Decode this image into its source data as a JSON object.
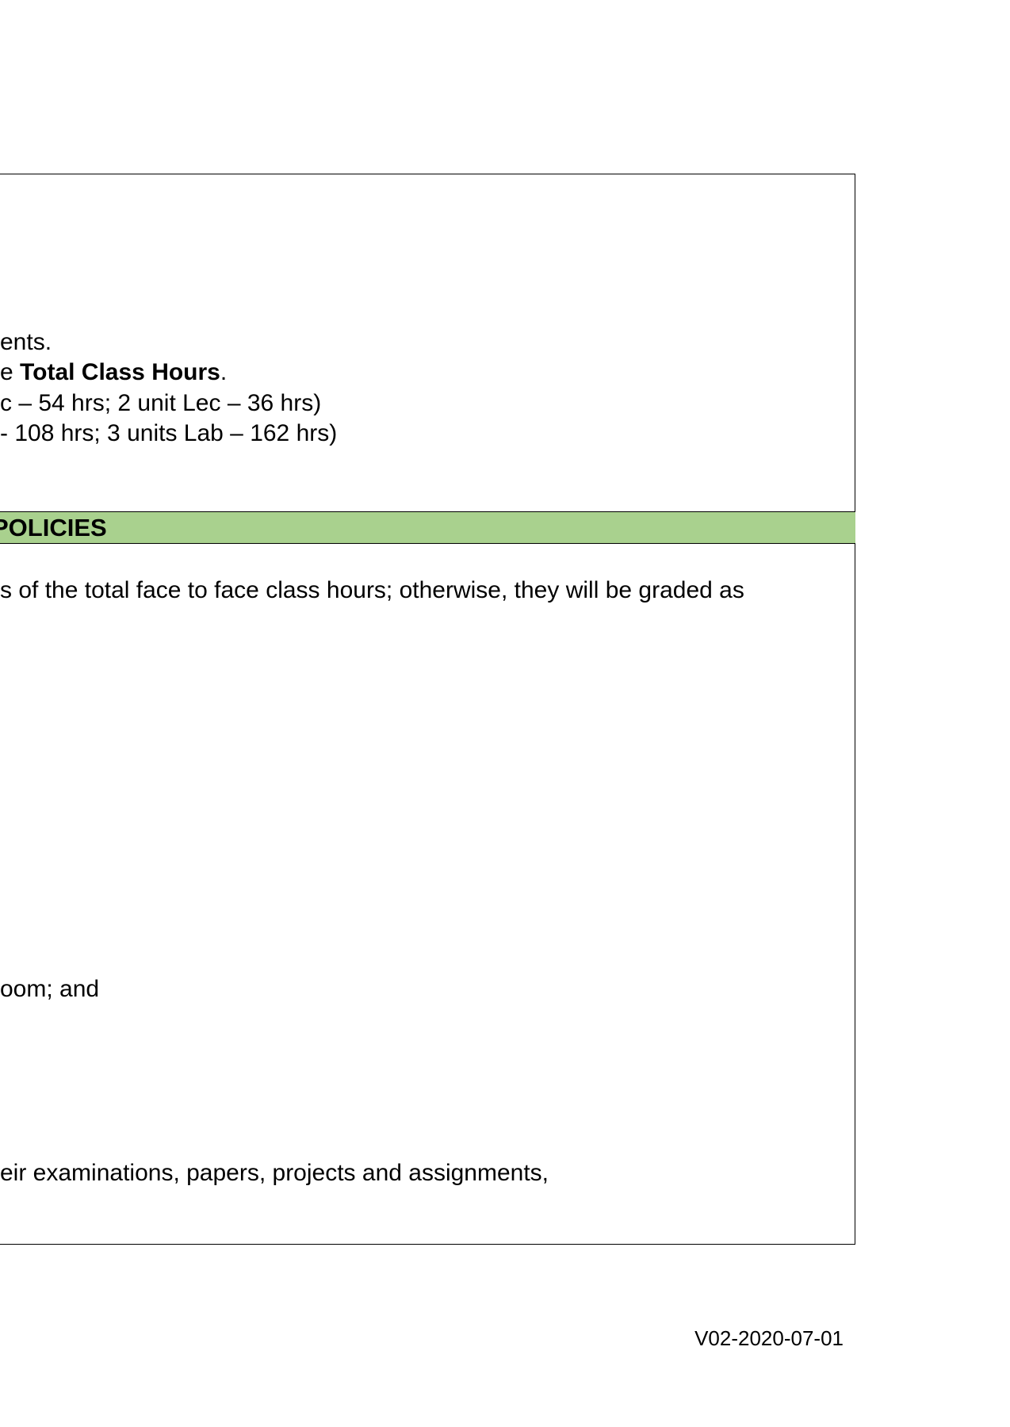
{
  "lines": {
    "l1": "ents.",
    "l2_prefix": "e ",
    "l2_bold": "Total Class Hours",
    "l2_suffix": ".",
    "l3": "c – 54 hrs; 2 unit Lec – 36 hrs)",
    "l4": "- 108 hrs; 3 units Lab – 162 hrs)"
  },
  "section": {
    "title": "POLICIES"
  },
  "policies": {
    "p1": "s of the total face to face class hours; otherwise, they will be graded as",
    "p2": "oom; and",
    "p3": "eir examinations, papers, projects and assignments,"
  },
  "footer": {
    "version": "V02-2020-07-01"
  },
  "colors": {
    "section_header_bg": "#a9d18e",
    "border": "#000000"
  }
}
